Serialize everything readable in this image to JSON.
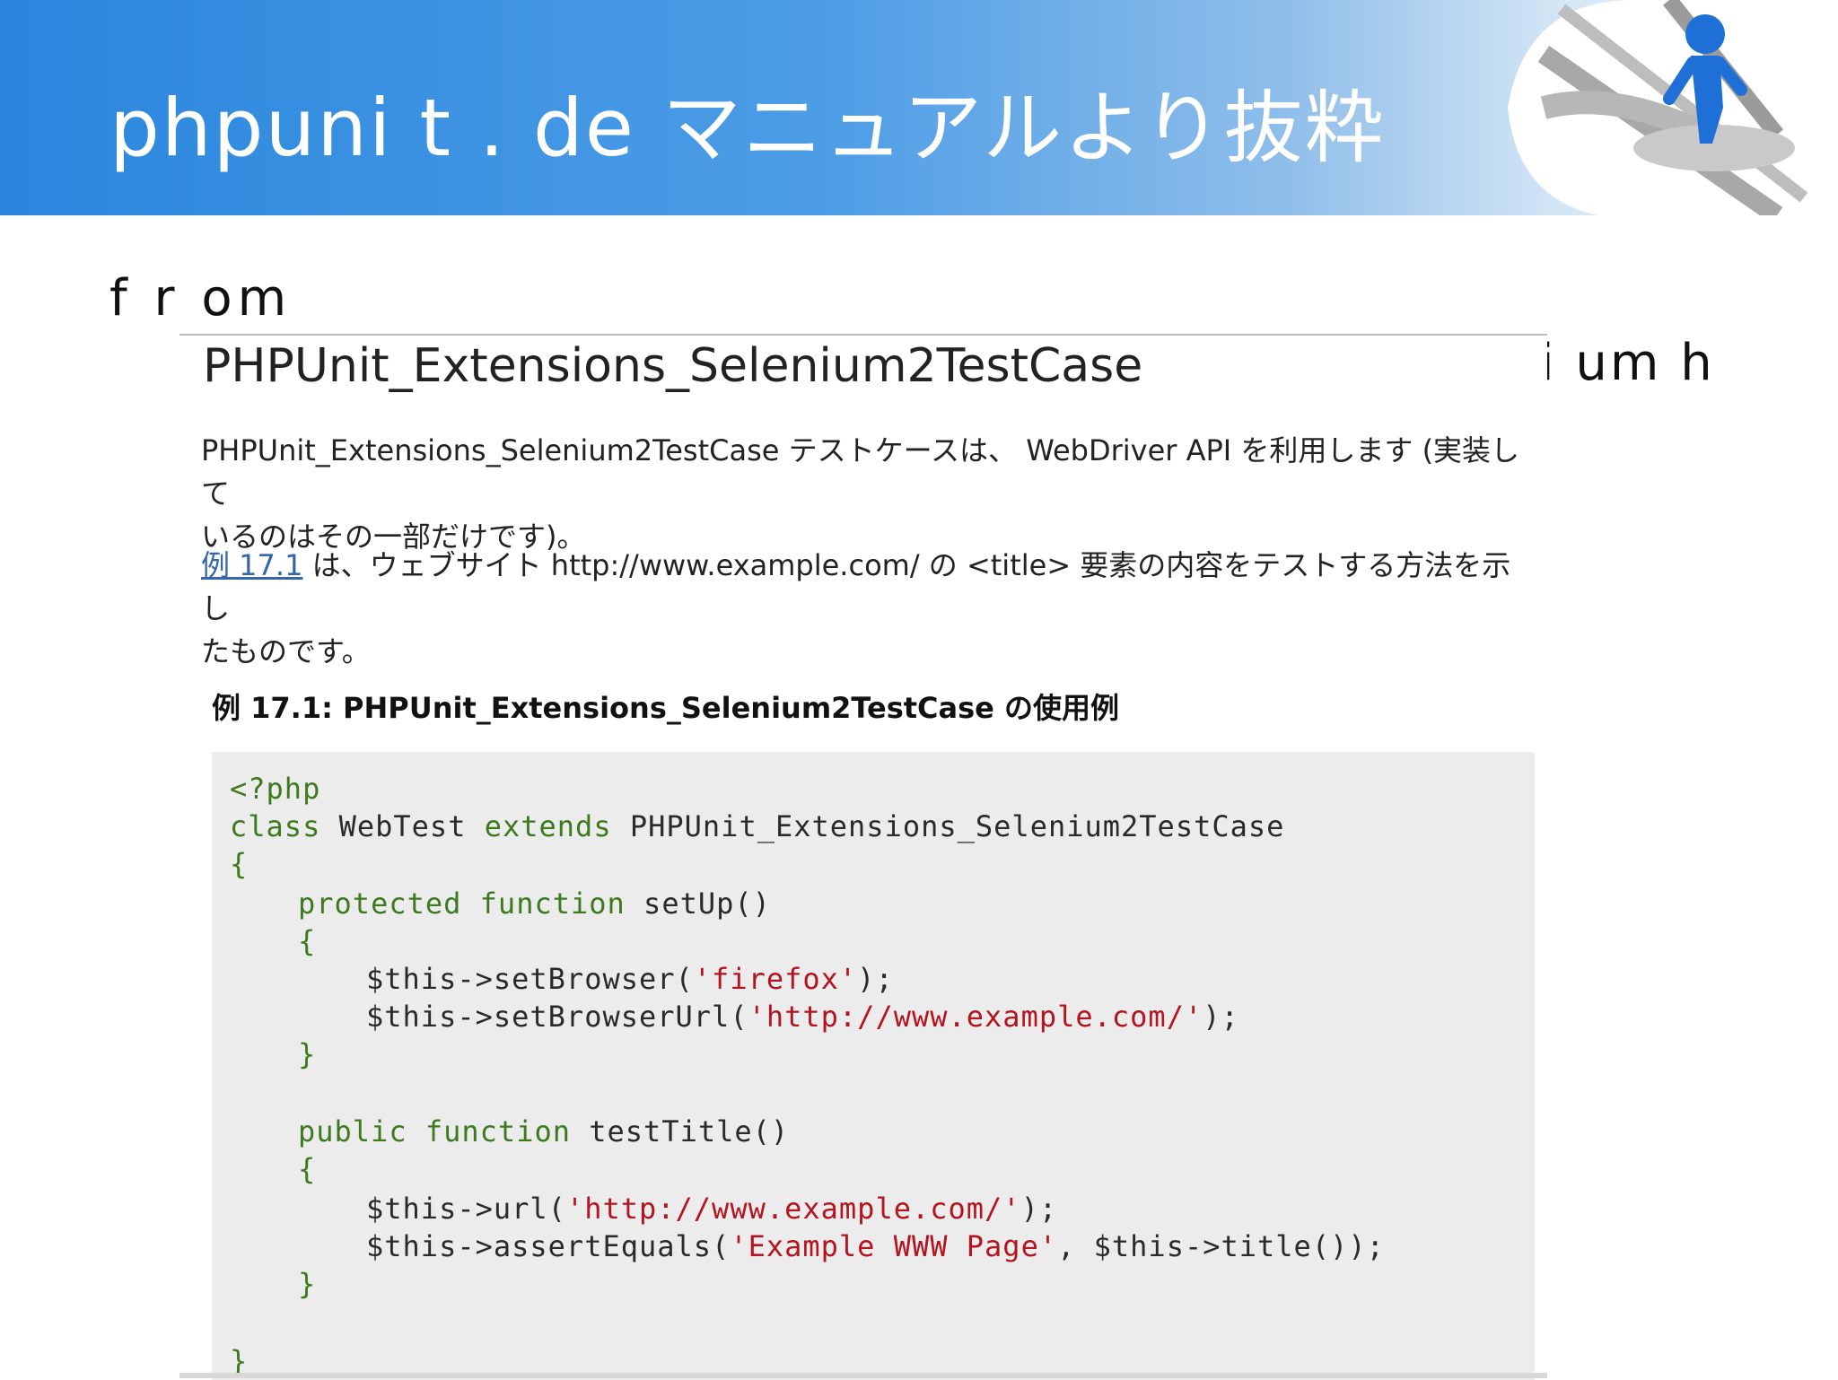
{
  "slide": {
    "title": "phpuni t . de マニュアルより抜粋",
    "from": "f r om",
    "tail": "i um h"
  },
  "manual": {
    "heading": "PHPUnit_Extensions_Selenium2TestCase",
    "para1_line1": "PHPUnit_Extensions_Selenium2TestCase テストケースは、 WebDriver API を利用します (実装して",
    "para1_line2": "いるのはその一部だけです)。",
    "para2_link": "例 17.1",
    "para2_line1_rest": " は、ウェブサイト http://www.example.com/ の <title> 要素の内容をテストする方法を示し",
    "para2_line2": "たものです。",
    "caption": "例 17.1: PHPUnit_Extensions_Selenium2TestCase の使用例"
  },
  "code": {
    "l1": "<?php",
    "l2_kw": "class",
    "l2_name": " WebTest ",
    "l2_kw2": "extends",
    "l2_rest": " PHPUnit_Extensions_Selenium2TestCase",
    "l3": "{",
    "l4_kw": "protected function",
    "l4_rest": " setUp()",
    "l5": "{",
    "l6_pre": "$this->setBrowser(",
    "l6_str": "'firefox'",
    "l6_post": ");",
    "l7_pre": "$this->setBrowserUrl(",
    "l7_str": "'http://www.example.com/'",
    "l7_post": ");",
    "l8": "}",
    "l9_kw": "public function",
    "l9_rest": " testTitle()",
    "l10": "{",
    "l11_pre": "$this->url(",
    "l11_str": "'http://www.example.com/'",
    "l11_post": ");",
    "l12_pre": "$this->assertEquals(",
    "l12_str": "'Example WWW Page'",
    "l12_post": ", $this->title());",
    "l13": "}",
    "l14": "}"
  }
}
